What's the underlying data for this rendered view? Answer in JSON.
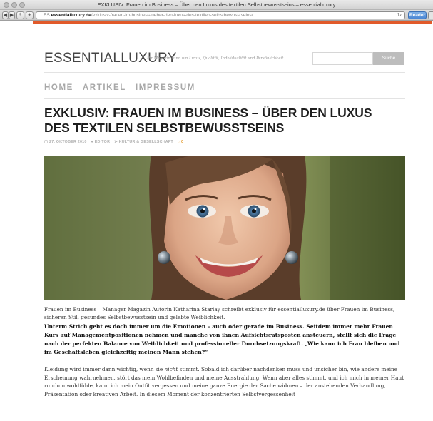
{
  "window": {
    "title": "EXKLUSIV: Frauen im Business – Über den Luxus des textilen Selbstbewusstseins – essentialluxury"
  },
  "browser": {
    "url_prefix": "ES",
    "url_domain": "essentialluxury.de",
    "url_path": "/exklusiv-frauen-im-business-ueber-den-luxus-des-textilen-selbstbewusstseins/",
    "reader_label": "Reader"
  },
  "site": {
    "logo": "ESSENTIALLUXURY",
    "tagline": "Ihr Magazin rund um Luxus, Qualität, Individualität und Persönlichkeit.",
    "search_button": "Suche"
  },
  "nav": {
    "items": [
      "HOME",
      "ARTIKEL",
      "IMPRESSUM"
    ]
  },
  "article": {
    "title": "EXKLUSIV: FRAUEN IM BUSINESS – ÜBER DEN LUXUS DES TEXTILEN SELBSTBEWUSSTSEINS",
    "date": "27. OKTOBER 2010",
    "author": "EDITOR",
    "category": "KULTUR & GESELLSCHAFT",
    "comments": "0",
    "caption": "Frauen im Business – Manager Magazin Autorin Katharina Starlay schreibt exklusiv für essentialluxury.de über Frauen im Business, sicheren Stil, gesundes Selbstbewusstsein und gelebte Weiblichkeit.",
    "lead": "Unterm Strich geht es doch immer um die Emotionen – auch oder gerade im Business. Seitdem immer mehr Frauen Kurs auf Managementpositionen nehmen und manche von ihnen Aufsichtsratsposten ansteuern, stellt sich die Frage nach der perfekten Balance von Weiblichkeit und professioneller Durchsetzungskraft. „Wie kann ich Frau bleiben und im Geschäftsleben gleichzeitig meinen Mann stehen?“",
    "body_part1": "Kleidung wird immer dann wichtig, wenn sie ",
    "body_emph": "nicht",
    "body_part2": " stimmt. Sobald ich darüber nachdenken muss und unsicher bin, wie andere meine Erscheinung wahrnehmen, stört das mein Wohlbefinden und meine Ausstrahlung. Wenn aber alles stimmt, und ich mich in meiner Haut rundum wohlfühle, kann ich mein Outfit vergessen und meine ganze Energie der Sache widmen – der anstehenden Verhandlung, Präsentation oder kreativen Arbeit. In diesem Moment der konzentrierten Selbstvergessenheit"
  },
  "colors": {
    "accent": "#e15a2a",
    "nav": "#a8a8a8",
    "reader": "#4a86d4"
  }
}
